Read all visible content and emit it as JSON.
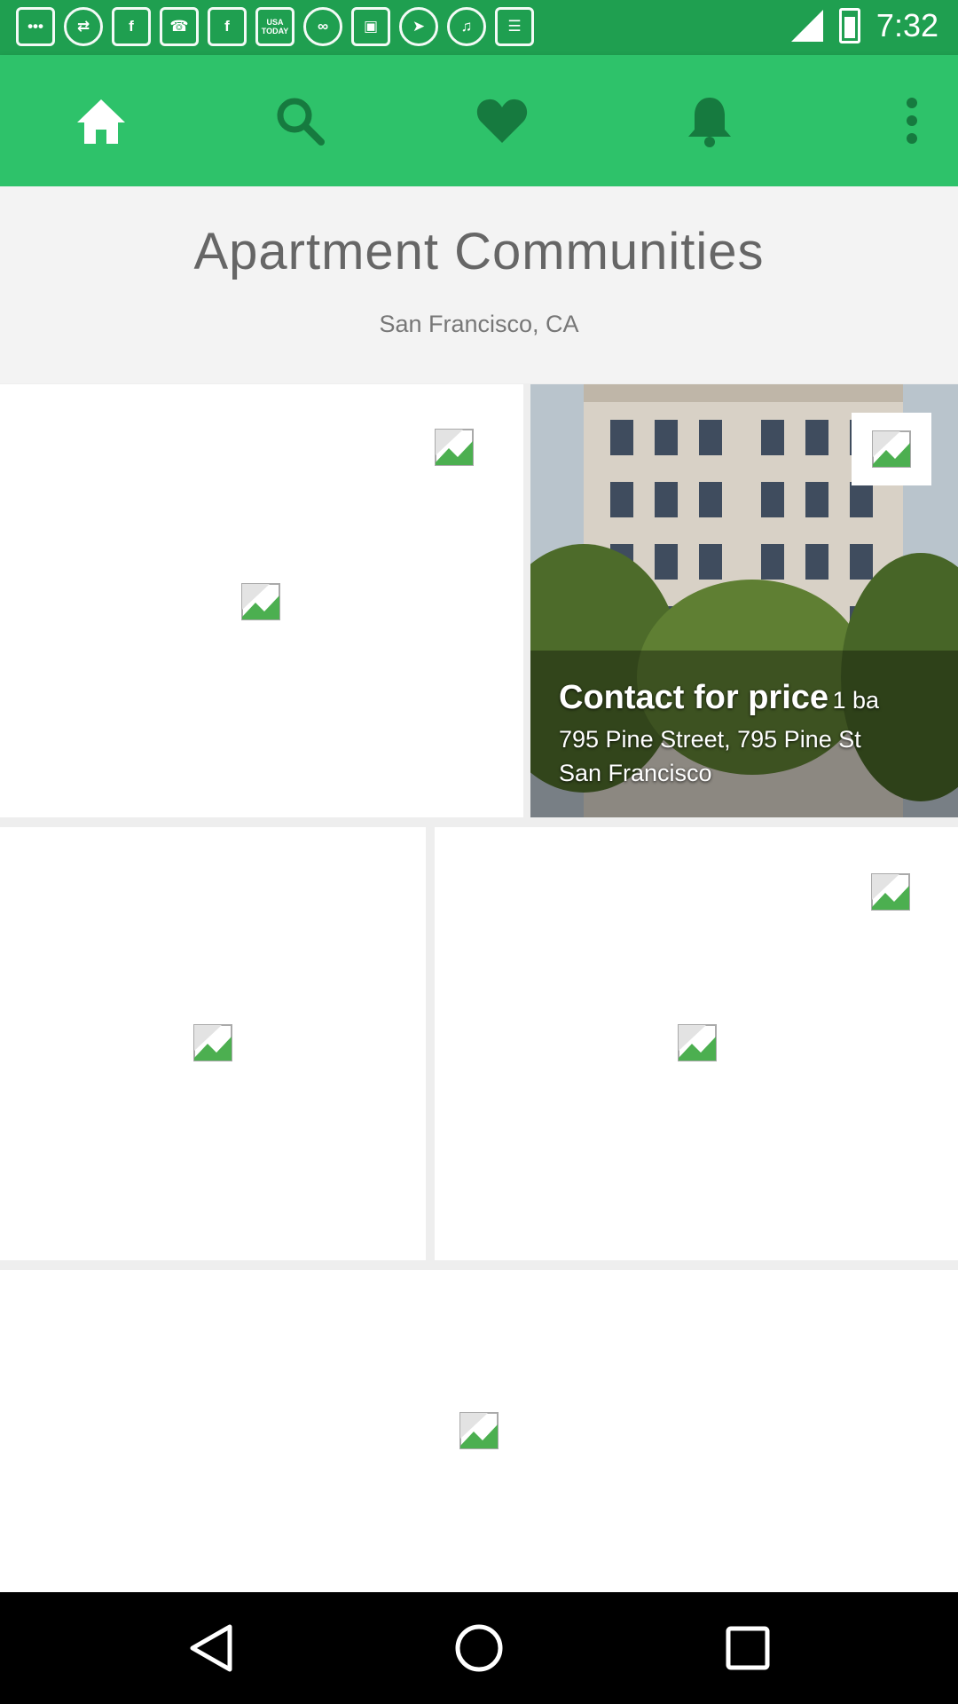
{
  "status_bar": {
    "time": "7:32",
    "icons": [
      "chat-icon",
      "usb-icon",
      "facebook-icon",
      "phone-icon",
      "facebook-icon",
      "usa-today-icon",
      "link-icon",
      "voicemail-icon",
      "compass-icon",
      "music-icon",
      "news-icon"
    ],
    "usa_today_label": "USA TODAY"
  },
  "toolbar": {
    "items": [
      "home-icon",
      "search-icon",
      "heart-icon",
      "bell-icon",
      "more-vert-icon"
    ],
    "active": "home-icon"
  },
  "header": {
    "title": "Apartment Communities",
    "subtitle": "San Francisco, CA"
  },
  "listing": {
    "price": "Contact for price",
    "beds": "1 ba",
    "address_line1": "795 Pine Street, 795 Pine St",
    "address_line2": "San Francisco"
  },
  "colors": {
    "accent": "#2ec26a",
    "status_bar": "#1f9f50",
    "background": "#eeeeee"
  }
}
